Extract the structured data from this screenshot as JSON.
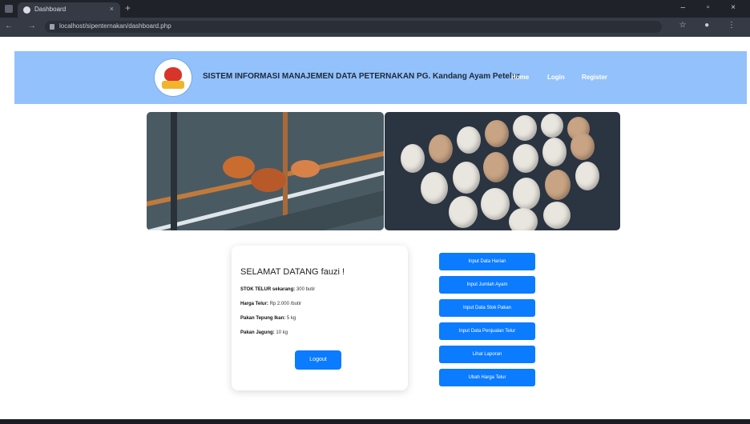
{
  "browser": {
    "tab_title": "Dashboard",
    "url": "localhost/sipenternakan/dashboard.php",
    "tab_close": "×",
    "new_tab": "+",
    "window_controls": "– ▫ ×",
    "nav_controls": "← → ⟳",
    "right_icons": "☆ ● ⋮"
  },
  "header": {
    "brand_title": "SISTEM INFORMASI MANAJEMEN DATA PETERNAKAN PG. Kandang Ayam Petelur",
    "nav": {
      "home": "Home",
      "login": "Login",
      "register": "Register"
    }
  },
  "welcome_card": {
    "greeting": "SELAMAT DATANG fauzi !",
    "stok_label": "STOK TELUR sekarang:",
    "stok_value": "300 butir",
    "harga_label": "Harga Telur:",
    "harga_value": "Rp 2.000 /butir",
    "pakan_tepung_label": "Pakan Tepung Ikan:",
    "pakan_tepung_value": "5 kg",
    "pakan_jagung_label": "Pakan Jagung:",
    "pakan_jagung_value": "10 kg",
    "logout_label": "Logout"
  },
  "actions": [
    "Input Data Harian",
    "Input Jumlah Ayam",
    "Input Data Stok Pakan",
    "Input Data Penjualan Telur",
    "Lihat Laporan",
    "Ubah Harga Telur"
  ]
}
